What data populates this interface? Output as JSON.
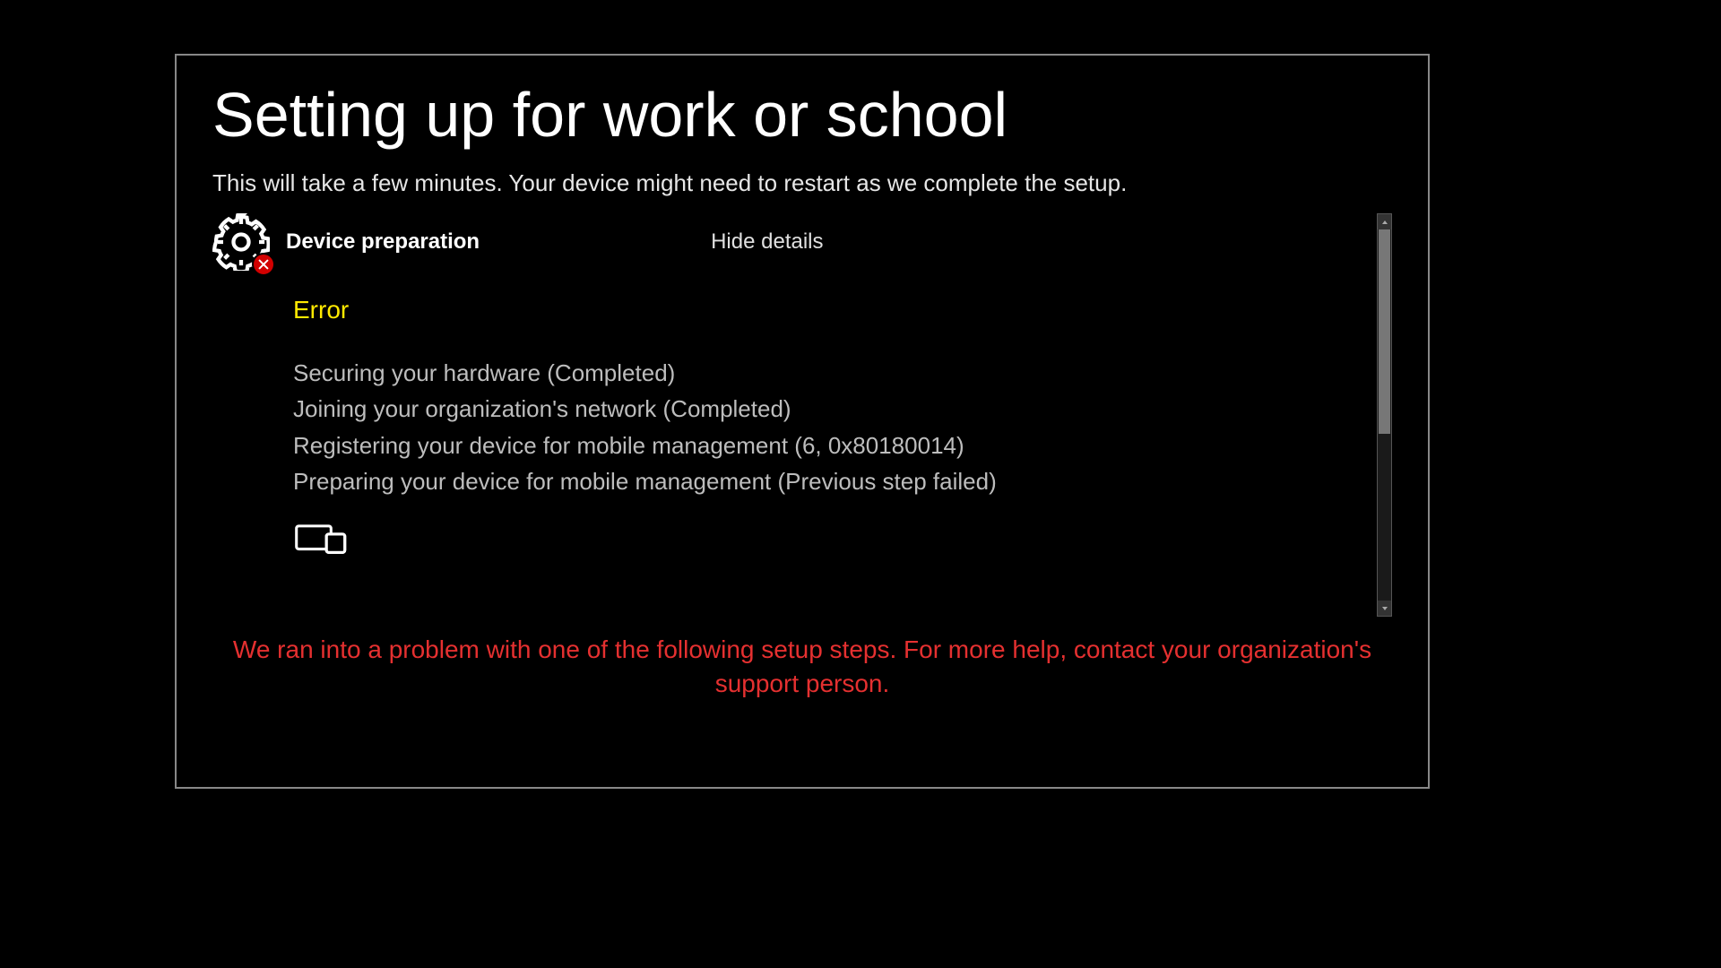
{
  "title": "Setting up for work or school",
  "subtitle": "This will take a few minutes. Your device might need to restart as we complete the setup.",
  "section": {
    "label": "Device preparation",
    "toggle": "Hide details",
    "status": "Error",
    "steps": [
      "Securing your hardware (Completed)",
      "Joining your organization's network (Completed)",
      "Registering your device for mobile management (6, 0x80180014)",
      "Preparing your device for mobile management (Previous step failed)"
    ]
  },
  "problem_message": "We ran into a problem with one of the following setup steps. For more help, contact your organization's support person."
}
